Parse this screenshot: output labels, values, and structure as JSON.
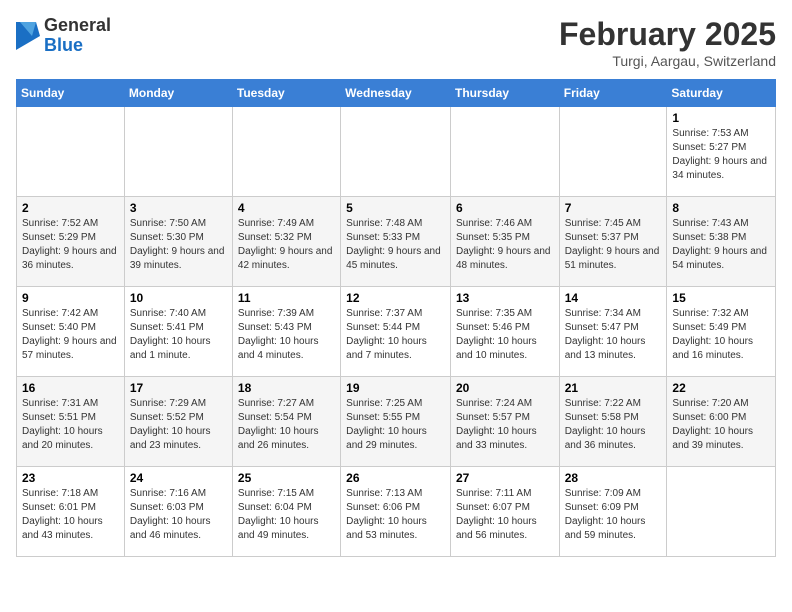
{
  "header": {
    "logo": {
      "general": "General",
      "blue": "Blue"
    },
    "title": "February 2025",
    "location": "Turgi, Aargau, Switzerland"
  },
  "calendar": {
    "days_of_week": [
      "Sunday",
      "Monday",
      "Tuesday",
      "Wednesday",
      "Thursday",
      "Friday",
      "Saturday"
    ],
    "weeks": [
      [
        {
          "day": "",
          "info": ""
        },
        {
          "day": "",
          "info": ""
        },
        {
          "day": "",
          "info": ""
        },
        {
          "day": "",
          "info": ""
        },
        {
          "day": "",
          "info": ""
        },
        {
          "day": "",
          "info": ""
        },
        {
          "day": "1",
          "info": "Sunrise: 7:53 AM\nSunset: 5:27 PM\nDaylight: 9 hours and 34 minutes."
        }
      ],
      [
        {
          "day": "2",
          "info": "Sunrise: 7:52 AM\nSunset: 5:29 PM\nDaylight: 9 hours and 36 minutes."
        },
        {
          "day": "3",
          "info": "Sunrise: 7:50 AM\nSunset: 5:30 PM\nDaylight: 9 hours and 39 minutes."
        },
        {
          "day": "4",
          "info": "Sunrise: 7:49 AM\nSunset: 5:32 PM\nDaylight: 9 hours and 42 minutes."
        },
        {
          "day": "5",
          "info": "Sunrise: 7:48 AM\nSunset: 5:33 PM\nDaylight: 9 hours and 45 minutes."
        },
        {
          "day": "6",
          "info": "Sunrise: 7:46 AM\nSunset: 5:35 PM\nDaylight: 9 hours and 48 minutes."
        },
        {
          "day": "7",
          "info": "Sunrise: 7:45 AM\nSunset: 5:37 PM\nDaylight: 9 hours and 51 minutes."
        },
        {
          "day": "8",
          "info": "Sunrise: 7:43 AM\nSunset: 5:38 PM\nDaylight: 9 hours and 54 minutes."
        }
      ],
      [
        {
          "day": "9",
          "info": "Sunrise: 7:42 AM\nSunset: 5:40 PM\nDaylight: 9 hours and 57 minutes."
        },
        {
          "day": "10",
          "info": "Sunrise: 7:40 AM\nSunset: 5:41 PM\nDaylight: 10 hours and 1 minute."
        },
        {
          "day": "11",
          "info": "Sunrise: 7:39 AM\nSunset: 5:43 PM\nDaylight: 10 hours and 4 minutes."
        },
        {
          "day": "12",
          "info": "Sunrise: 7:37 AM\nSunset: 5:44 PM\nDaylight: 10 hours and 7 minutes."
        },
        {
          "day": "13",
          "info": "Sunrise: 7:35 AM\nSunset: 5:46 PM\nDaylight: 10 hours and 10 minutes."
        },
        {
          "day": "14",
          "info": "Sunrise: 7:34 AM\nSunset: 5:47 PM\nDaylight: 10 hours and 13 minutes."
        },
        {
          "day": "15",
          "info": "Sunrise: 7:32 AM\nSunset: 5:49 PM\nDaylight: 10 hours and 16 minutes."
        }
      ],
      [
        {
          "day": "16",
          "info": "Sunrise: 7:31 AM\nSunset: 5:51 PM\nDaylight: 10 hours and 20 minutes."
        },
        {
          "day": "17",
          "info": "Sunrise: 7:29 AM\nSunset: 5:52 PM\nDaylight: 10 hours and 23 minutes."
        },
        {
          "day": "18",
          "info": "Sunrise: 7:27 AM\nSunset: 5:54 PM\nDaylight: 10 hours and 26 minutes."
        },
        {
          "day": "19",
          "info": "Sunrise: 7:25 AM\nSunset: 5:55 PM\nDaylight: 10 hours and 29 minutes."
        },
        {
          "day": "20",
          "info": "Sunrise: 7:24 AM\nSunset: 5:57 PM\nDaylight: 10 hours and 33 minutes."
        },
        {
          "day": "21",
          "info": "Sunrise: 7:22 AM\nSunset: 5:58 PM\nDaylight: 10 hours and 36 minutes."
        },
        {
          "day": "22",
          "info": "Sunrise: 7:20 AM\nSunset: 6:00 PM\nDaylight: 10 hours and 39 minutes."
        }
      ],
      [
        {
          "day": "23",
          "info": "Sunrise: 7:18 AM\nSunset: 6:01 PM\nDaylight: 10 hours and 43 minutes."
        },
        {
          "day": "24",
          "info": "Sunrise: 7:16 AM\nSunset: 6:03 PM\nDaylight: 10 hours and 46 minutes."
        },
        {
          "day": "25",
          "info": "Sunrise: 7:15 AM\nSunset: 6:04 PM\nDaylight: 10 hours and 49 minutes."
        },
        {
          "day": "26",
          "info": "Sunrise: 7:13 AM\nSunset: 6:06 PM\nDaylight: 10 hours and 53 minutes."
        },
        {
          "day": "27",
          "info": "Sunrise: 7:11 AM\nSunset: 6:07 PM\nDaylight: 10 hours and 56 minutes."
        },
        {
          "day": "28",
          "info": "Sunrise: 7:09 AM\nSunset: 6:09 PM\nDaylight: 10 hours and 59 minutes."
        },
        {
          "day": "",
          "info": ""
        }
      ]
    ]
  }
}
